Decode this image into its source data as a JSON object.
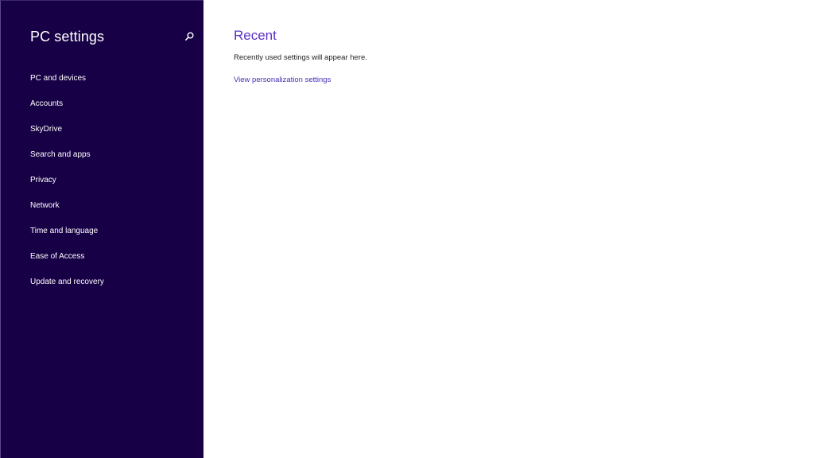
{
  "sidebar": {
    "title": "PC settings",
    "search_icon": "search-icon",
    "items": [
      {
        "label": "PC and devices"
      },
      {
        "label": "Accounts"
      },
      {
        "label": "SkyDrive"
      },
      {
        "label": "Search and apps"
      },
      {
        "label": "Privacy"
      },
      {
        "label": "Network"
      },
      {
        "label": "Time and language"
      },
      {
        "label": "Ease of Access"
      },
      {
        "label": "Update and recovery"
      }
    ]
  },
  "main": {
    "title": "Recent",
    "description": "Recently used settings will appear here.",
    "link_label": "View personalization settings"
  },
  "colors": {
    "sidebar_bg": "#170046",
    "accent": "#5a2fc6",
    "link": "#4a2fb8"
  }
}
